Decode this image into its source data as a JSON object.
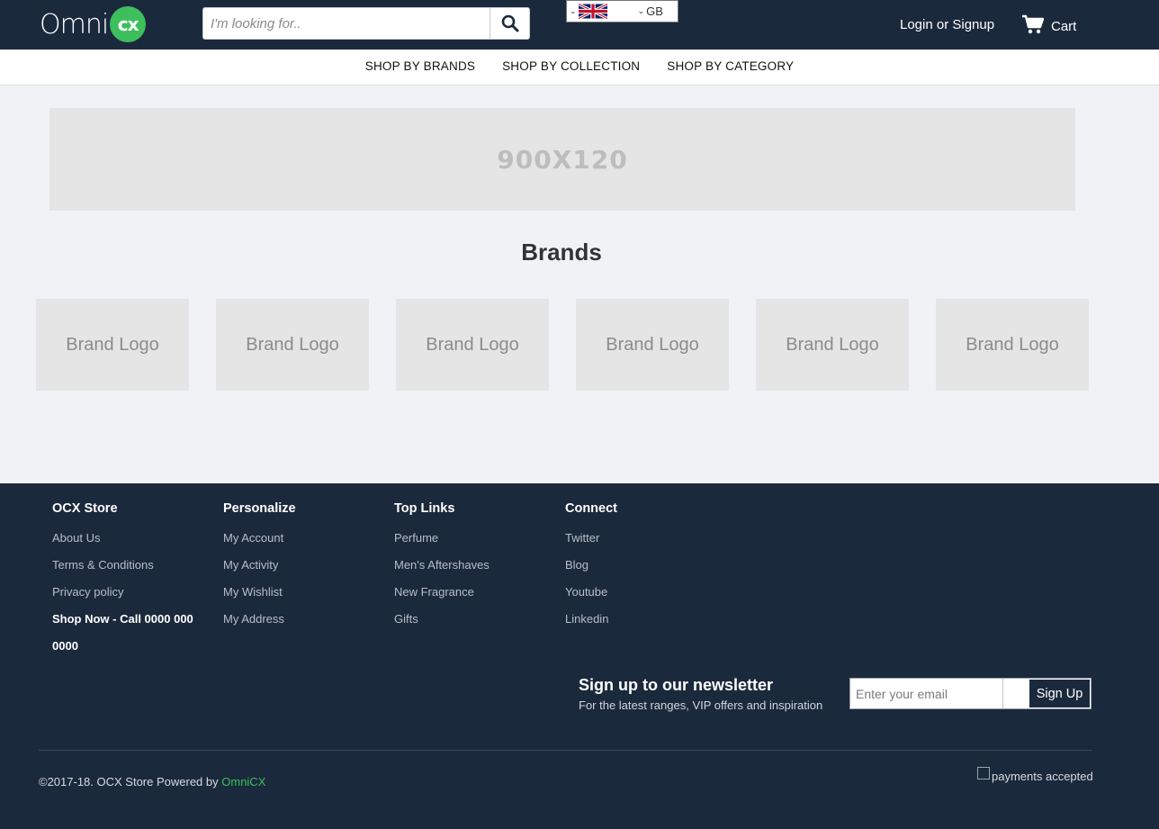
{
  "header": {
    "logo_text": "Omni",
    "logo_badge": "cx",
    "search_placeholder": "I'm looking for..",
    "language": "GB",
    "login_label": "Login or Signup",
    "cart_label": "Cart",
    "icons": {
      "search": "search-icon",
      "cart": "cart-icon",
      "flag": "uk-flag-icon"
    }
  },
  "nav": {
    "items": [
      "SHOP BY BRANDS",
      "SHOP BY COLLECTION",
      "SHOP BY CATEGORY"
    ]
  },
  "banner": {
    "text": "900X120"
  },
  "brands": {
    "title": "Brands",
    "tiles": [
      "Brand Logo",
      "Brand Logo",
      "Brand Logo",
      "Brand Logo",
      "Brand Logo",
      "Brand Logo"
    ]
  },
  "footer": {
    "columns": [
      {
        "title": "OCX Store",
        "links": [
          "About Us",
          "Terms & Conditions",
          "Privacy policy"
        ],
        "call": "Shop Now - Call 0000 000 0000"
      },
      {
        "title": "Personalize",
        "links": [
          "My Account",
          "My Activity",
          "My Wishlist",
          "My Address"
        ]
      },
      {
        "title": "Top Links",
        "links": [
          "Perfume",
          "Men's Aftershaves",
          "New Fragrance",
          "Gifts"
        ]
      },
      {
        "title": "Connect",
        "links": [
          "Twitter",
          "Blog",
          "Youtube",
          "Linkedin"
        ]
      }
    ],
    "newsletter": {
      "title": "Sign up to our newsletter",
      "subtitle": "For the latest ranges, VIP offers and inspiration",
      "email_placeholder": "Enter your email",
      "button_label": "Sign Up"
    },
    "copyright_prefix": "©2017-18. OCX Store Powered by ",
    "copyright_link": "OmniCX",
    "payments_alt": "payments accepted"
  },
  "colors": {
    "header_bg": "#1b293c",
    "accent_green": "#3dbf5e",
    "page_bg": "#f1f2f6",
    "placeholder_bg": "#e5e5e5"
  }
}
